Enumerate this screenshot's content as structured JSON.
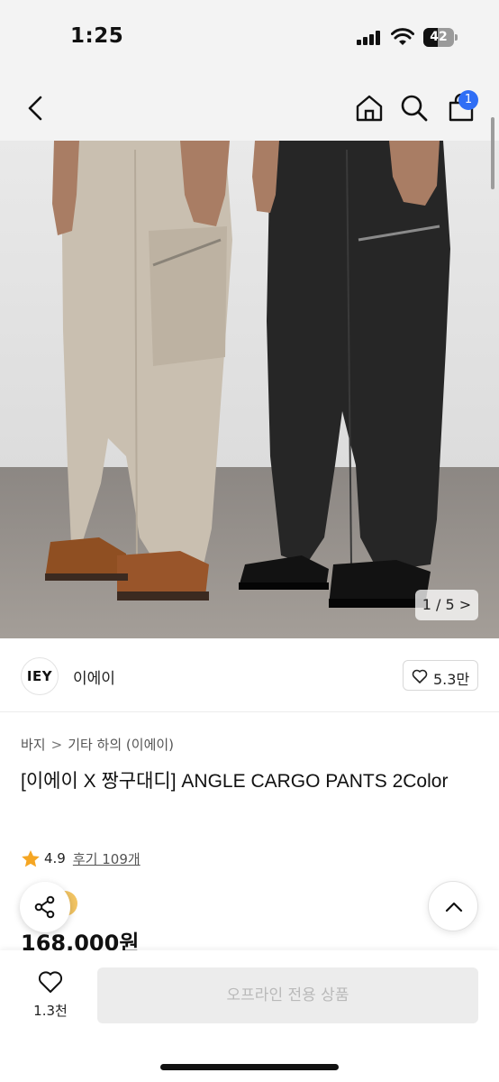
{
  "status_bar": {
    "time": "1:25",
    "battery_level": "42",
    "icons": [
      "signal-icon",
      "wifi-icon",
      "battery-icon"
    ]
  },
  "header": {
    "icons": [
      "back-icon",
      "home-icon",
      "search-icon",
      "cart-icon"
    ],
    "cart_badge": "1"
  },
  "gallery": {
    "counter": "1 / 5 >",
    "current_index": 1,
    "total": 5
  },
  "brand": {
    "logo_text": "IEY",
    "name": "이에이",
    "likes": "5.3만"
  },
  "breadcrumb": {
    "items": [
      "바지",
      "기타 하의 (이에이)"
    ],
    "separator": ">"
  },
  "product": {
    "title": "[이에이 X 짱구대디] ANGLE CARGO PANTS 2Color",
    "rating": "4.9",
    "review_link": "후기 109개",
    "price": "168,000원"
  },
  "bottom_bar": {
    "wish_count": "1.3천",
    "buy_label": "오프라인 전용 상품"
  },
  "colors": {
    "accent_badge": "#2f6ef5",
    "star": "#f5a623",
    "disabled_button_bg": "#ececec",
    "disabled_button_text": "#b9b9b9"
  }
}
